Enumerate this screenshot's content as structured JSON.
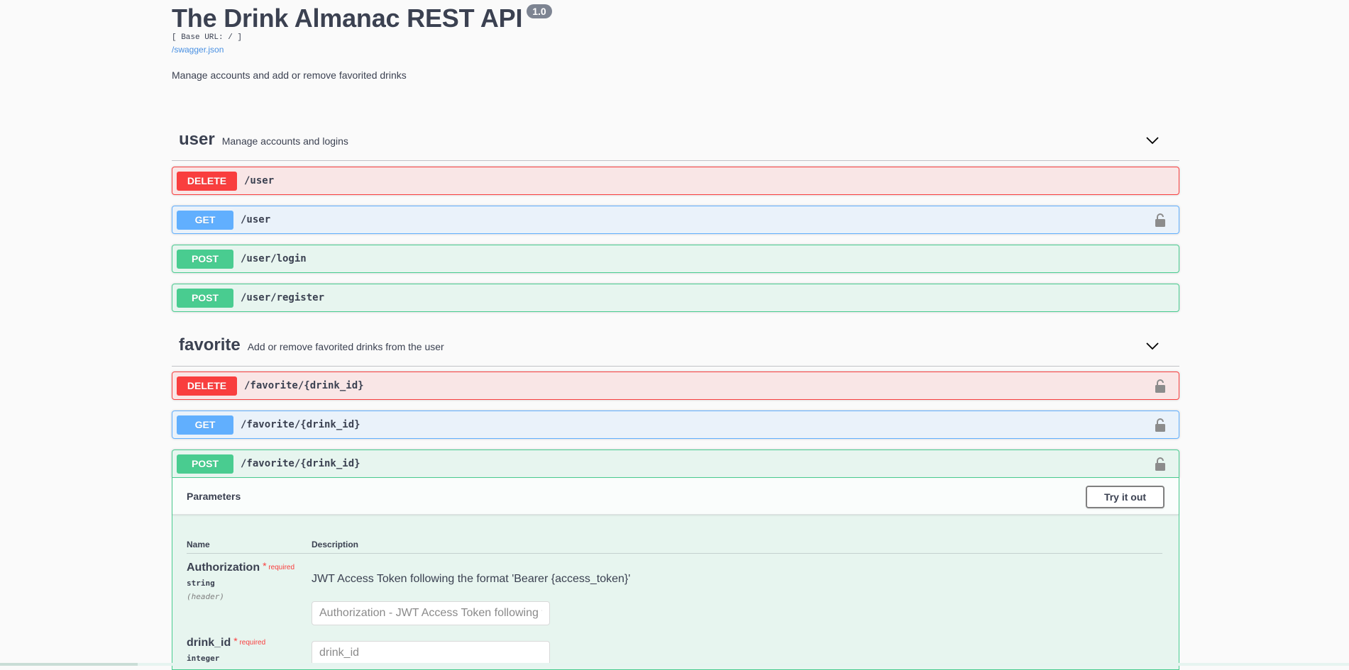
{
  "info": {
    "title": "The Drink Almanac REST API",
    "version": "1.0",
    "base_url": "[ Base URL: / ]",
    "spec_link": "/swagger.json",
    "description": "Manage accounts and add or remove favorited drinks"
  },
  "tags": [
    {
      "name": "user",
      "description": "Manage accounts and logins",
      "operations": [
        {
          "method": "DELETE",
          "path": "/user",
          "locked": false
        },
        {
          "method": "GET",
          "path": "/user",
          "locked": true
        },
        {
          "method": "POST",
          "path": "/user/login",
          "locked": false
        },
        {
          "method": "POST",
          "path": "/user/register",
          "locked": false
        }
      ]
    },
    {
      "name": "favorite",
      "description": "Add or remove favorited drinks from the user",
      "operations": [
        {
          "method": "DELETE",
          "path": "/favorite/{drink_id}",
          "locked": true
        },
        {
          "method": "GET",
          "path": "/favorite/{drink_id}",
          "locked": true
        },
        {
          "method": "POST",
          "path": "/favorite/{drink_id}",
          "locked": true
        }
      ]
    }
  ],
  "expanded": {
    "parameters_title": "Parameters",
    "try_button": "Try it out",
    "col_name": "Name",
    "col_description": "Description",
    "params": [
      {
        "name": "Authorization",
        "required_star": "*",
        "required_label": "required",
        "type": "string",
        "in": "(header)",
        "description": "JWT Access Token following the format 'Bearer {access_token}'",
        "placeholder": "Authorization - JWT Access Token following t"
      },
      {
        "name": "drink_id",
        "required_star": "*",
        "required_label": "required",
        "type": "integer",
        "placeholder": "drink_id"
      }
    ]
  },
  "colors": {
    "delete": "#f93e3e",
    "get": "#61affe",
    "post": "#49cc90",
    "link": "#4990e2"
  }
}
